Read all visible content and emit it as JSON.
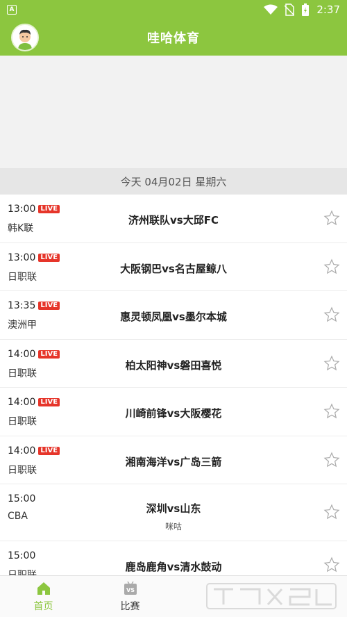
{
  "status_bar": {
    "time": "2:37"
  },
  "header": {
    "title": "哇哈体育"
  },
  "date_bar": {
    "text": "今天 04月02日 星期六"
  },
  "live_label": "LIVE",
  "matches": [
    {
      "time": "13:00",
      "live": true,
      "league": "韩K联",
      "teams": "济州联队vs大邱FC"
    },
    {
      "time": "13:00",
      "live": true,
      "league": "日职联",
      "teams": "大阪钢巴vs名古屋鲸八"
    },
    {
      "time": "13:35",
      "live": true,
      "league": "澳洲甲",
      "teams": "惠灵顿凤凰vs墨尔本城"
    },
    {
      "time": "14:00",
      "live": true,
      "league": "日职联",
      "teams": "柏太阳神vs磐田喜悦"
    },
    {
      "time": "14:00",
      "live": true,
      "league": "日职联",
      "teams": "川崎前锋vs大阪樱花"
    },
    {
      "time": "14:00",
      "live": true,
      "league": "日职联",
      "teams": "湘南海洋vs广岛三箭"
    },
    {
      "time": "15:00",
      "live": false,
      "league": "CBA",
      "teams": "深圳vs山东",
      "note": "咪咕"
    },
    {
      "time": "15:00",
      "live": false,
      "league": "日职联",
      "teams": "鹿岛鹿角vs清水鼓动"
    }
  ],
  "tabs": [
    {
      "label": "首页",
      "icon": "home-icon",
      "active": true
    },
    {
      "label": "比赛",
      "icon": "vs-icon",
      "active": false
    }
  ],
  "colors": {
    "brand": "#8cc63f",
    "live": "#e6352a"
  }
}
